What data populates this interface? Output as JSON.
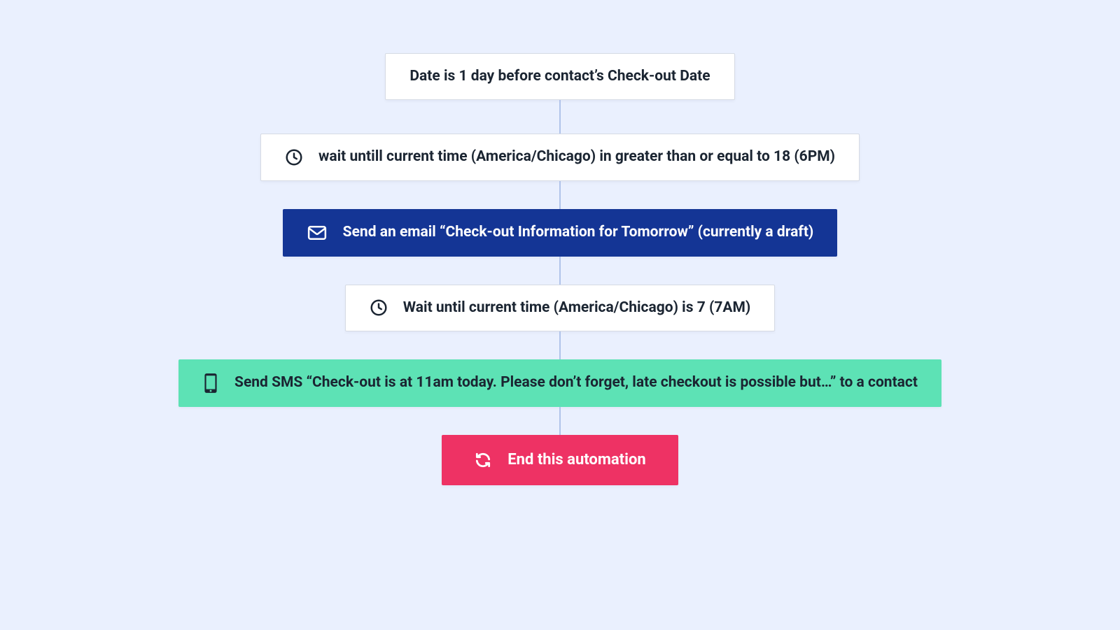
{
  "flow": {
    "trigger": {
      "label": "Date is 1 day before contact’s Check-out Date",
      "icon": null
    },
    "wait1": {
      "label": "wait untill current time (America/Chicago) in greater than or equal to 18 (6PM)",
      "icon": "clock"
    },
    "email": {
      "label": "Send an email “Check-out Information for Tomorrow” (currently a draft)",
      "icon": "envelope"
    },
    "wait2": {
      "label": "Wait until current time (America/Chicago) is 7 (7AM)",
      "icon": "clock"
    },
    "sms": {
      "label": "Send SMS “Check-out is at 11am today. Please don’t forget, late checkout is possible but…” to a contact",
      "icon": "phone"
    },
    "end": {
      "label": "End this automation",
      "icon": "sync"
    }
  },
  "colors": {
    "bg": "#eaf0fe",
    "card_white": "#ffffff",
    "card_border": "#d6dbe4",
    "blue": "#143595",
    "teal": "#5de2b5",
    "pink": "#ee3264",
    "connector": "#b0c3ea",
    "text_dark": "#1b2532"
  }
}
